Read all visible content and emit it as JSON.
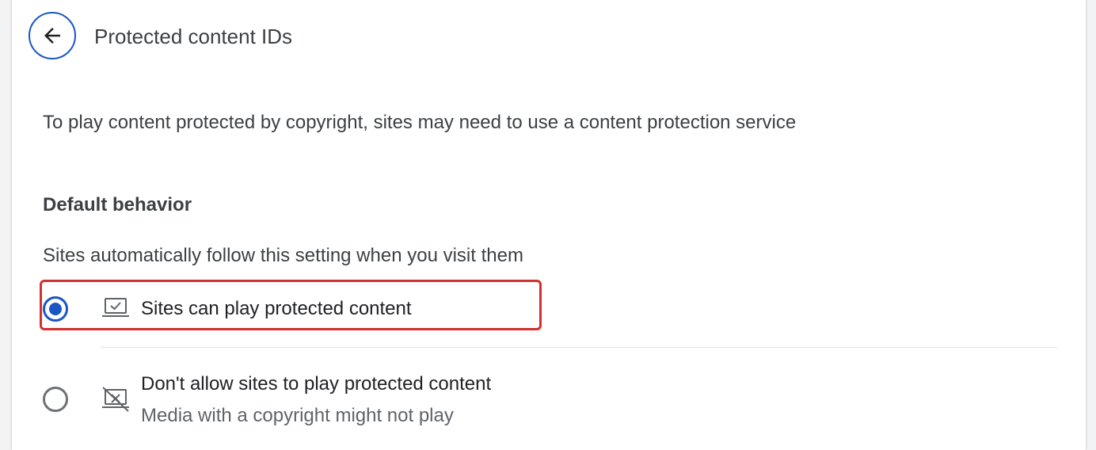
{
  "header": {
    "back_icon": "arrow-left-icon",
    "title": "Protected content IDs"
  },
  "description": "To play content protected by copyright, sites may need to use a content protection service",
  "default_behavior": {
    "heading": "Default behavior",
    "subheading": "Sites automatically follow this setting when you visit them",
    "options": [
      {
        "label": "Sites can play protected content",
        "icon": "laptop-check-icon",
        "selected": true
      },
      {
        "label": "Don't allow sites to play protected content",
        "sublabel": "Media with a copyright might not play",
        "icon": "laptop-blocked-icon",
        "selected": false
      }
    ]
  },
  "colors": {
    "accent": "#1a56c4",
    "highlight": "#d32f2f",
    "text_primary": "#202124",
    "text_secondary": "#5f6368"
  }
}
